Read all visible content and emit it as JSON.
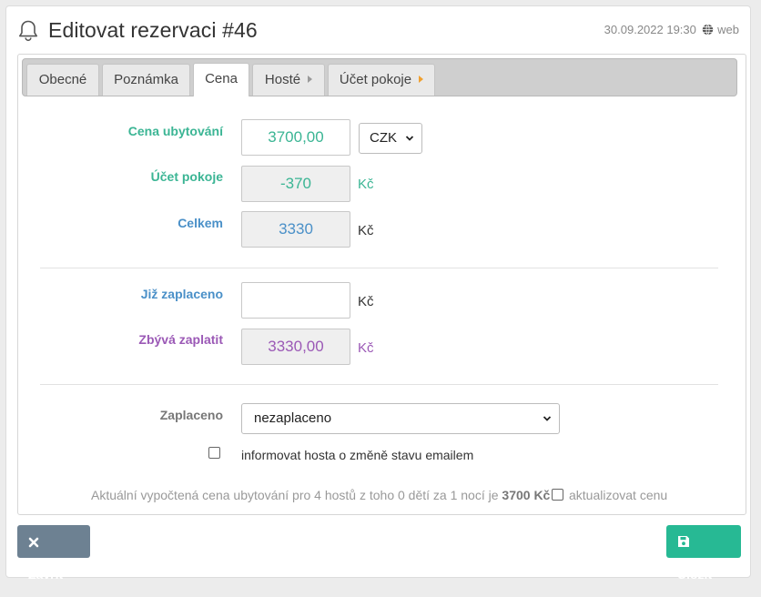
{
  "header": {
    "title": "Editovat rezervaci #46",
    "datetime": "30.09.2022 19:30",
    "source": "web"
  },
  "tabs": [
    {
      "label": "Obecné",
      "active": false,
      "arrow": false
    },
    {
      "label": "Poznámka",
      "active": false,
      "arrow": false
    },
    {
      "label": "Cena",
      "active": true,
      "arrow": false
    },
    {
      "label": "Hosté",
      "active": false,
      "arrow": true
    },
    {
      "label": "Účet pokoje",
      "active": false,
      "arrow": true
    }
  ],
  "form": {
    "price_label": "Cena ubytování",
    "price_value": "3700,00",
    "currency": "CZK",
    "room_account_label": "Účet pokoje",
    "room_account_value": "-370",
    "room_account_unit": "Kč",
    "total_label": "Celkem",
    "total_value": "3330",
    "total_unit": "Kč",
    "paid_label": "Již zaplaceno",
    "paid_value": "",
    "paid_unit": "Kč",
    "remaining_label": "Zbývá zaplatit",
    "remaining_value": "3330,00",
    "remaining_unit": "Kč",
    "status_label": "Zaplaceno",
    "status_value": "nezaplaceno",
    "notify_label": "informovat hosta o změně stavu emailem",
    "info_text": "Aktuální vypočtená cena ubytování pro 4 hostů z toho 0 dětí za 1 nocí je",
    "info_price": "3700 Kč",
    "update_label": "aktualizovat cenu"
  },
  "buttons": {
    "close": "Zavřít",
    "save": "Uložit"
  },
  "colors": {
    "green": "#3bb594",
    "blue": "#4a90c8",
    "purple": "#9b59b6",
    "save_button": "#27b994",
    "close_button": "#6d8192"
  }
}
